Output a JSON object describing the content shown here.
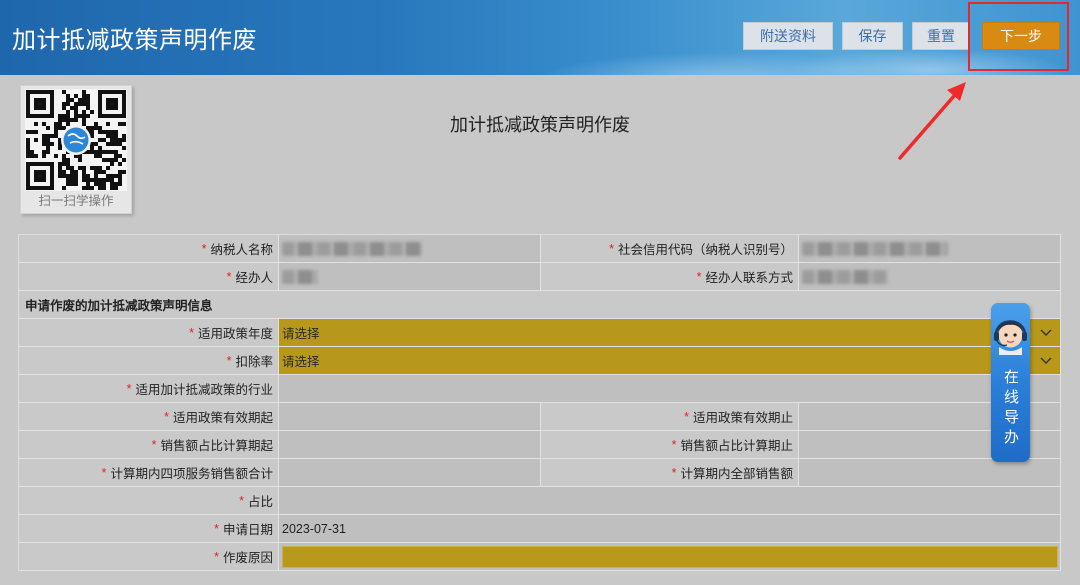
{
  "header": {
    "title": "加计抵减政策声明作废",
    "buttons": [
      {
        "label": "附送资料"
      },
      {
        "label": "保存"
      },
      {
        "label": "重置"
      },
      {
        "label": "下一步"
      }
    ]
  },
  "qr": {
    "caption": "扫一扫学操作"
  },
  "page": {
    "title": "加计抵减政策声明作废"
  },
  "form": {
    "required_mark": "*",
    "taxpayer_name_label": "纳税人名称",
    "credit_code_label": "社会信用代码（纳税人识别号）",
    "agent_label": "经办人",
    "agent_contact_label": "经办人联系方式",
    "section_title": "申请作废的加计抵减政策声明信息",
    "policy_year_label": "适用政策年度",
    "policy_year_value": "请选择",
    "deduction_rate_label": "扣除率",
    "deduction_rate_value": "请选择",
    "industry_label": "适用加计抵减政策的行业",
    "validity_start_label": "适用政策有效期起",
    "validity_end_label": "适用政策有效期止",
    "sales_ratio_start_label": "销售额占比计算期起",
    "sales_ratio_end_label": "销售额占比计算期止",
    "four_services_sales_label": "计算期内四项服务销售额合计",
    "total_sales_label": "计算期内全部销售额",
    "ratio_label": "占比",
    "apply_date_label": "申请日期",
    "apply_date_value": "2023-07-31",
    "cancel_reason_label": "作废原因"
  },
  "widget": {
    "label": "在线导办"
  },
  "icons": {
    "select_arrow": "chevron-down-icon",
    "qr": "qr-code",
    "assistant": "customer-service-avatar-icon",
    "annotation": "red-arrow-annotation"
  },
  "colors": {
    "header_blue": "#2877bc",
    "next_button_orange": "#d88a12",
    "select_gold": "#b7981a",
    "highlight_red": "#e5282b",
    "required_red": "#e02424",
    "widget_blue": "#2a7fd8"
  }
}
